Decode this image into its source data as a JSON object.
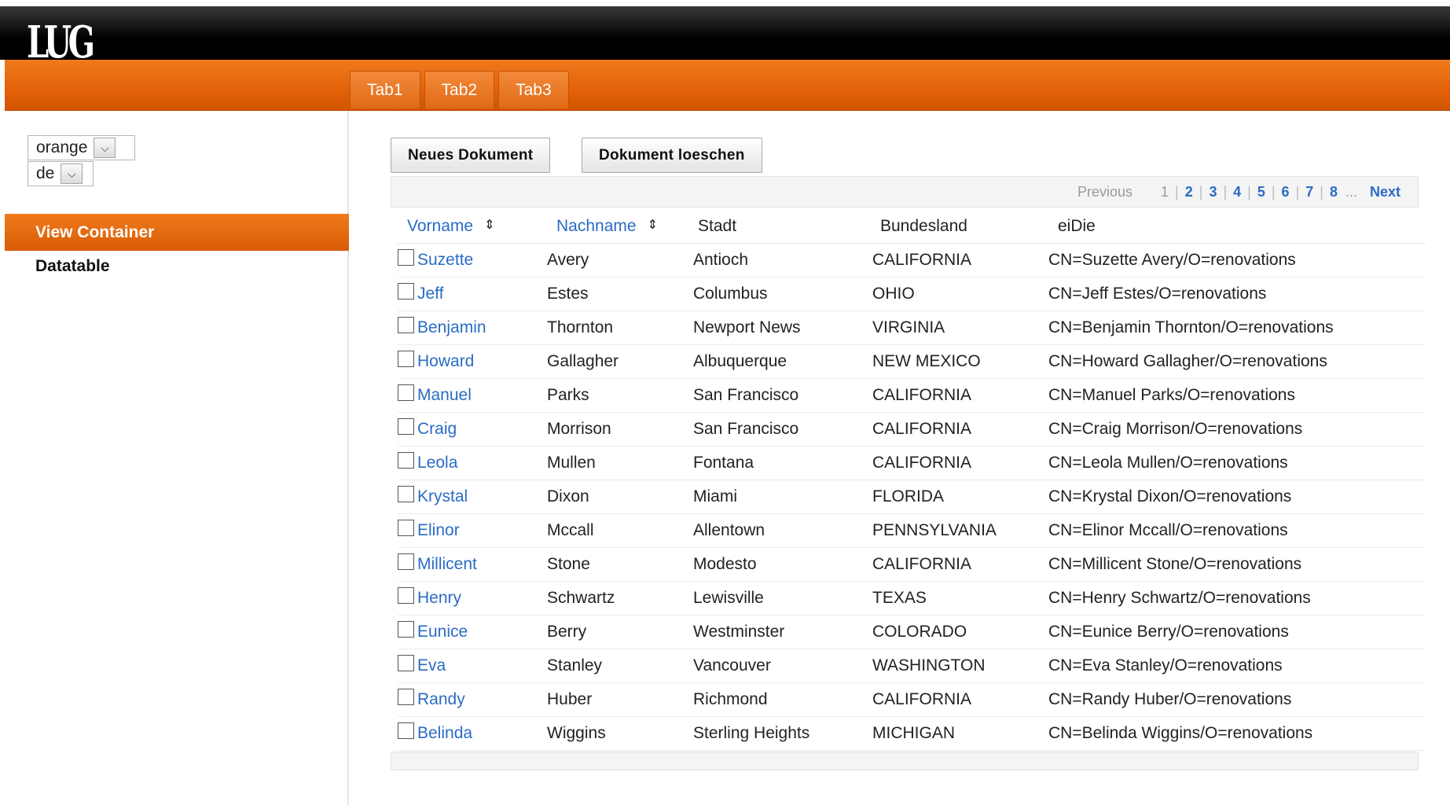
{
  "header": {
    "logo_text": "LUG"
  },
  "tabs": [
    {
      "label": "Tab1"
    },
    {
      "label": "Tab2"
    },
    {
      "label": "Tab3"
    }
  ],
  "sidebar": {
    "theme_select": {
      "value": "orange"
    },
    "lang_select": {
      "value": "de"
    },
    "items": [
      {
        "label": "View Container",
        "active": true
      },
      {
        "label": "Datatable",
        "active": false
      }
    ]
  },
  "toolbar": {
    "new_label": "Neues Dokument",
    "delete_label": "Dokument loeschen"
  },
  "pager": {
    "previous": "Previous",
    "current": "1",
    "pages": [
      "2",
      "3",
      "4",
      "5",
      "6",
      "7",
      "8"
    ],
    "ellipsis": "...",
    "next": "Next"
  },
  "table": {
    "columns": [
      "Vorname",
      "Nachname",
      "Stadt",
      "Bundesland",
      "eiDie"
    ],
    "rows": [
      [
        "Suzette",
        "Avery",
        "Antioch",
        "CALIFORNIA",
        "CN=Suzette Avery/O=renovations"
      ],
      [
        "Jeff",
        "Estes",
        "Columbus",
        "OHIO",
        "CN=Jeff Estes/O=renovations"
      ],
      [
        "Benjamin",
        "Thornton",
        "Newport News",
        "VIRGINIA",
        "CN=Benjamin Thornton/O=renovations"
      ],
      [
        "Howard",
        "Gallagher",
        "Albuquerque",
        "NEW MEXICO",
        "CN=Howard Gallagher/O=renovations"
      ],
      [
        "Manuel",
        "Parks",
        "San Francisco",
        "CALIFORNIA",
        "CN=Manuel Parks/O=renovations"
      ],
      [
        "Craig",
        "Morrison",
        "San Francisco",
        "CALIFORNIA",
        "CN=Craig Morrison/O=renovations"
      ],
      [
        "Leola",
        "Mullen",
        "Fontana",
        "CALIFORNIA",
        "CN=Leola Mullen/O=renovations"
      ],
      [
        "Krystal",
        "Dixon",
        "Miami",
        "FLORIDA",
        "CN=Krystal Dixon/O=renovations"
      ],
      [
        "Elinor",
        "Mccall",
        "Allentown",
        "PENNSYLVANIA",
        "CN=Elinor Mccall/O=renovations"
      ],
      [
        "Millicent",
        "Stone",
        "Modesto",
        "CALIFORNIA",
        "CN=Millicent Stone/O=renovations"
      ],
      [
        "Henry",
        "Schwartz",
        "Lewisville",
        "TEXAS",
        "CN=Henry Schwartz/O=renovations"
      ],
      [
        "Eunice",
        "Berry",
        "Westminster",
        "COLORADO",
        "CN=Eunice Berry/O=renovations"
      ],
      [
        "Eva",
        "Stanley",
        "Vancouver",
        "WASHINGTON",
        "CN=Eva Stanley/O=renovations"
      ],
      [
        "Randy",
        "Huber",
        "Richmond",
        "CALIFORNIA",
        "CN=Randy Huber/O=renovations"
      ],
      [
        "Belinda",
        "Wiggins",
        "Sterling Heights",
        "MICHIGAN",
        "CN=Belinda Wiggins/O=renovations"
      ]
    ]
  },
  "colors": {
    "orange": "#e3620a",
    "link": "#2a6cc4"
  }
}
